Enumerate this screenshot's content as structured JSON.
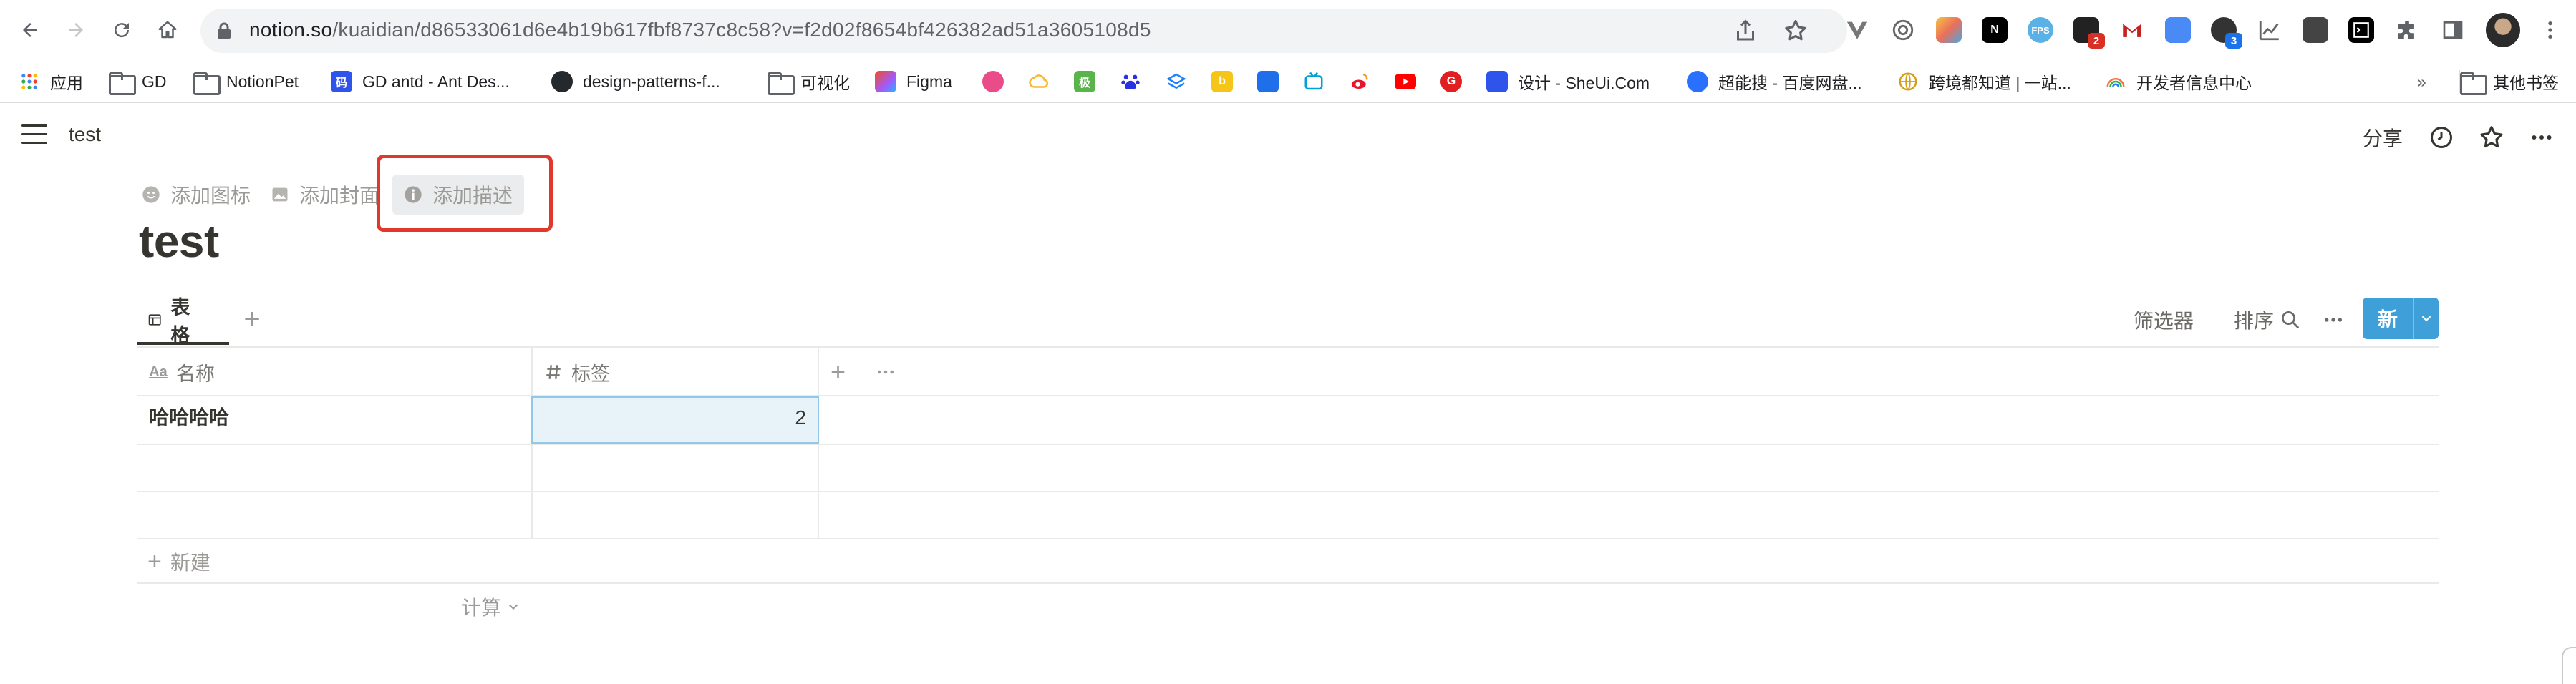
{
  "browser": {
    "url_host": "notion.so",
    "url_path": "/kuaidian/d86533061d6e4b19b617fbf8737c8c58?v=f2d02f8654bf426382ad51a3605108d5",
    "extensions": [
      {
        "name": "vue-devtools-icon",
        "color": "#555"
      },
      {
        "name": "cycle-icon",
        "color": "#555"
      },
      {
        "name": "colorful-hex-icon",
        "color": "#e8a33b"
      },
      {
        "name": "notion-icon",
        "color": "#000"
      },
      {
        "name": "fps-icon",
        "color": "#5ab1e6",
        "label": "FPS"
      },
      {
        "name": "dark-ext-icon",
        "color": "#222",
        "badge": "2",
        "badge_color": "#d93025"
      },
      {
        "name": "gmail-ext-icon",
        "color": "#c5221f"
      },
      {
        "name": "blue-box-icon",
        "color": "#4a8af4"
      },
      {
        "name": "github-ext-icon",
        "color": "#333",
        "badge": "3",
        "badge_color": "#1a73e8"
      },
      {
        "name": "chart-ext-icon",
        "color": "#555"
      },
      {
        "name": "screen-ext-icon",
        "color": "#444"
      },
      {
        "name": "terminal-ext-icon",
        "color": "#000"
      },
      {
        "name": "puzzle-icon",
        "color": "#5f6368"
      },
      {
        "name": "sidepanel-icon",
        "color": "#5f6368"
      }
    ]
  },
  "bookmarks": [
    {
      "label": "应用",
      "icon": "apps-grid-icon"
    },
    {
      "label": "GD",
      "icon": "folder-icon"
    },
    {
      "label": "NotionPet",
      "icon": "folder-icon"
    },
    {
      "label": "GD antd - Ant Des...",
      "icon": "antd-icon",
      "color": "#2f54eb",
      "glyph": "码"
    },
    {
      "label": "design-patterns-f...",
      "icon": "github-icon",
      "color": "#24292e"
    },
    {
      "label": "可视化",
      "icon": "folder-icon"
    },
    {
      "label": "Figma",
      "icon": "figma-icon",
      "color": "#f24e1e"
    },
    {
      "label": "",
      "icon": "dribbble-icon",
      "color": "#ea4c89"
    },
    {
      "label": "",
      "icon": "cloud-icon",
      "color": "#f7b733"
    },
    {
      "label": "",
      "icon": "green-tile-icon",
      "color": "#59b44b",
      "glyph": "极"
    },
    {
      "label": "",
      "icon": "baidu-icon",
      "color": "#2932e1"
    },
    {
      "label": "",
      "icon": "layers-icon",
      "color": "#1e80ff"
    },
    {
      "label": "",
      "icon": "yellow-b-icon",
      "color": "#f5c518",
      "glyph": "b"
    },
    {
      "label": "",
      "icon": "blue-f-icon",
      "color": "#1f6feb"
    },
    {
      "label": "",
      "icon": "bilibili-icon",
      "color": "#00a1d6"
    },
    {
      "label": "",
      "icon": "weibo-icon",
      "color": "#e6162d"
    },
    {
      "label": "",
      "icon": "youtube-icon",
      "color": "#ff0000"
    },
    {
      "label": "",
      "icon": "red-g-icon",
      "color": "#e02020",
      "glyph": "G"
    },
    {
      "label": "设计 - SheUi.Com",
      "icon": "sheui-icon",
      "color": "#2f54eb"
    },
    {
      "label": "超能搜 - 百度网盘...",
      "icon": "search-disc-icon",
      "color": "#2970ff"
    },
    {
      "label": "跨境都知道 | 一站...",
      "icon": "globe-icon",
      "color": "#d4a017"
    },
    {
      "label": "开发者信息中心",
      "icon": "rainbow-icon",
      "color": "#ff6f3c"
    }
  ],
  "bookmarks_overflow": "»",
  "bookmarks_other": "其他书签",
  "page": {
    "breadcrumb": "test",
    "share_label": "分享",
    "actions": {
      "add_icon": "添加图标",
      "add_cover": "添加封面",
      "add_description": "添加描述"
    },
    "title": "test"
  },
  "database": {
    "view_tab": "表格",
    "filter": "筛选器",
    "sort": "排序",
    "new_button": "新",
    "columns": [
      {
        "label": "名称",
        "icon": "text-aa-icon"
      },
      {
        "label": "标签",
        "icon": "hash-icon"
      }
    ],
    "rows": [
      {
        "name": "哈哈哈哈",
        "value": "2"
      },
      {
        "name": "",
        "value": ""
      },
      {
        "name": "",
        "value": ""
      }
    ],
    "new_row": "新建",
    "calculate": "计算"
  },
  "colors": {
    "accent_blue": "#3e9fd9",
    "highlight_red": "#e0382a",
    "selected_cell_bg": "#e7f3f8"
  }
}
